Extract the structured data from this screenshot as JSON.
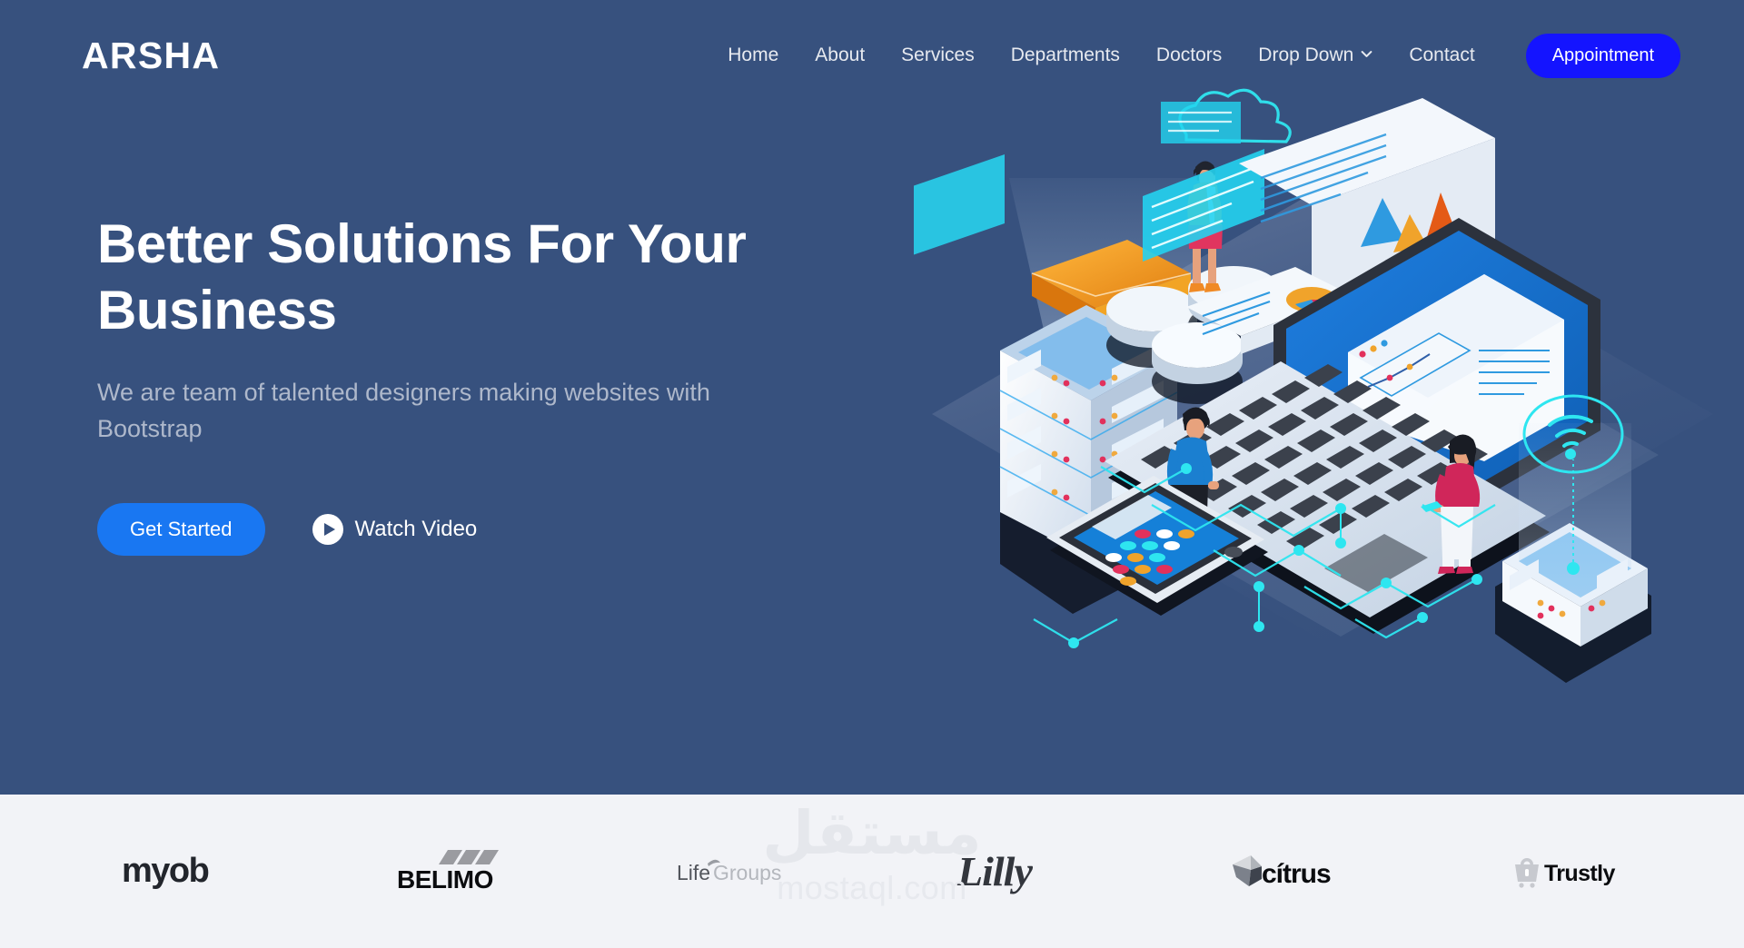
{
  "site": {
    "logo": "ARSHA",
    "accent_blue": "#1977f2",
    "appointment_blue": "#1414ff",
    "hero_bg": "#37517e",
    "clients_bg": "#f2f3f7"
  },
  "nav": {
    "items": [
      {
        "label": "Home",
        "name": "nav-item-home",
        "has_caret": false
      },
      {
        "label": "About",
        "name": "nav-item-about",
        "has_caret": false
      },
      {
        "label": "Services",
        "name": "nav-item-services",
        "has_caret": false
      },
      {
        "label": "Departments",
        "name": "nav-item-departments",
        "has_caret": false
      },
      {
        "label": "Doctors",
        "name": "nav-item-doctors",
        "has_caret": false
      },
      {
        "label": "Drop Down",
        "name": "nav-item-dropdown",
        "has_caret": true
      },
      {
        "label": "Contact",
        "name": "nav-item-contact",
        "has_caret": false
      }
    ],
    "appointment_label": "Appointment"
  },
  "hero": {
    "title": "Better Solutions For Your Business",
    "subtitle": "We are team of talented designers making websites with Bootstrap",
    "primary_cta": "Get Started",
    "secondary_cta": "Watch Video",
    "play_icon": "play-icon",
    "illustration": "isometric-technology-illustration"
  },
  "clients": {
    "logos": [
      {
        "name": "client-logo-myob",
        "label": "myob"
      },
      {
        "name": "client-logo-belimo",
        "label": "BELIMO"
      },
      {
        "name": "client-logo-lifegroups",
        "label": "LifeGroups"
      },
      {
        "name": "client-logo-lilly",
        "label": "Lilly"
      },
      {
        "name": "client-logo-citrus",
        "label": "cítrus"
      },
      {
        "name": "client-logo-trustly",
        "label": "Trustly"
      }
    ]
  },
  "watermark": {
    "arabic": "مستقل",
    "latin": "mostaql.com"
  }
}
